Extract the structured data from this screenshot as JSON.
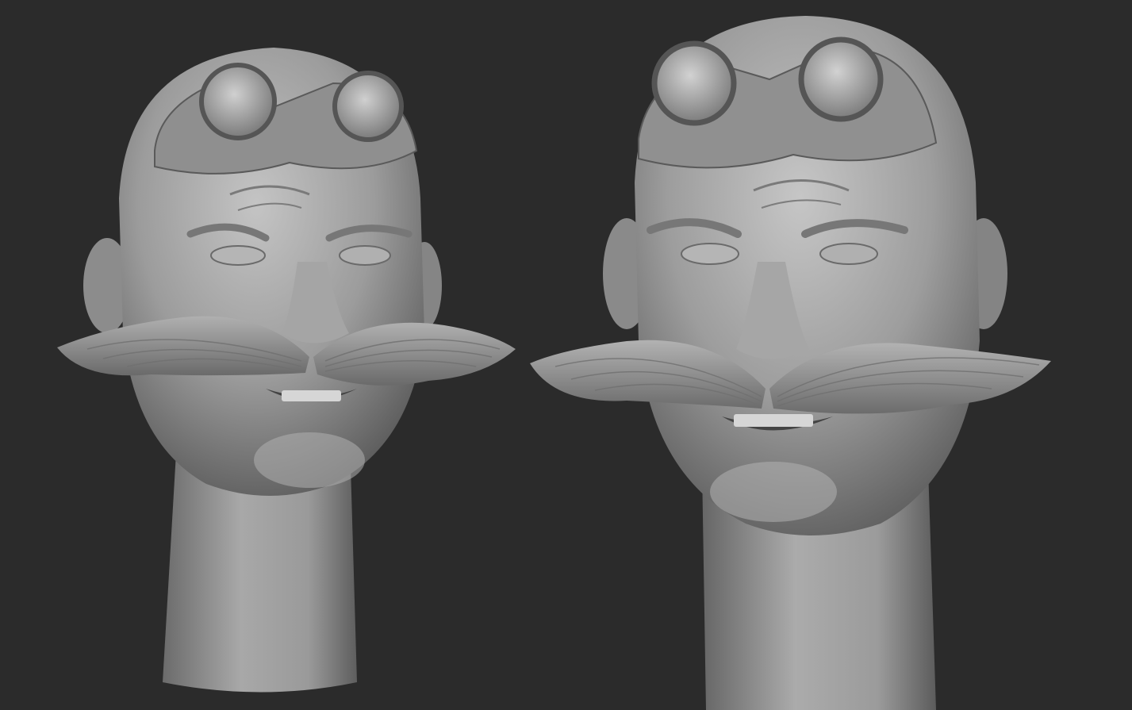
{
  "scene": {
    "background_color": "#2b2b2b",
    "material_color": "#9a9a9a",
    "views": [
      {
        "id": "front",
        "description_icon": "sculpt-head-icon"
      },
      {
        "id": "closeup",
        "description_icon": "sculpt-head-icon"
      }
    ]
  }
}
